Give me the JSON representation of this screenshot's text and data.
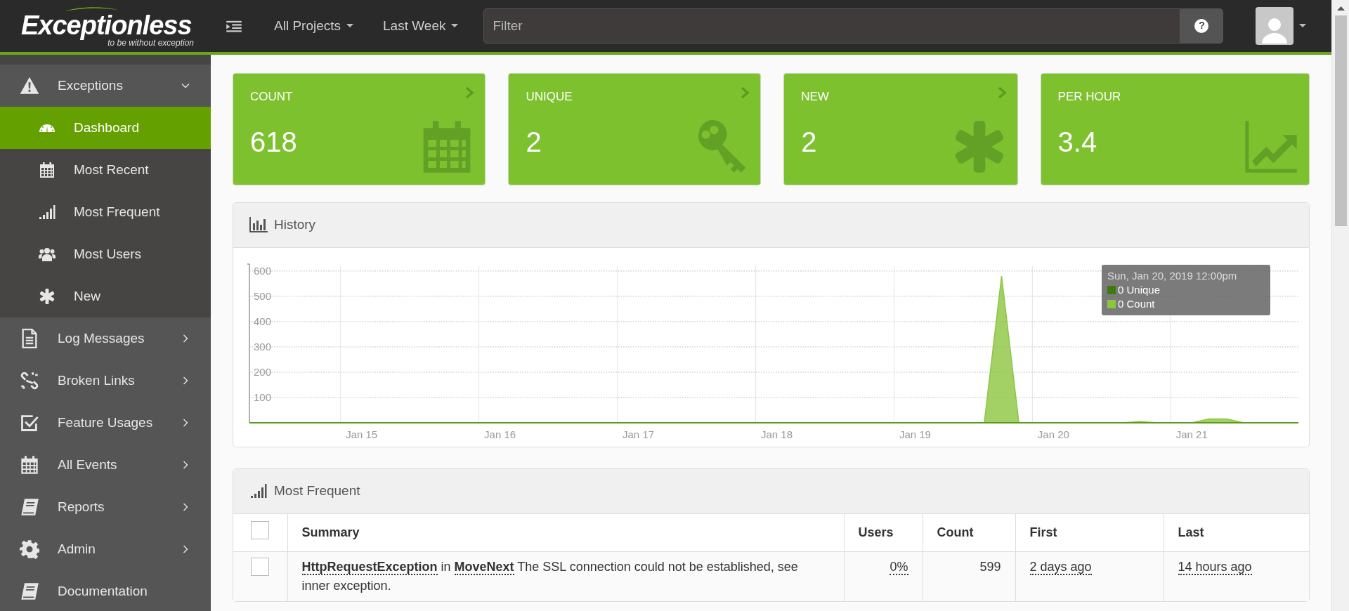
{
  "topbar": {
    "logo": "Exceptionless",
    "tagline": "to be without exception",
    "project_menu": "All Projects",
    "time_menu": "Last Week",
    "filter": {
      "placeholder": "Filter"
    },
    "help_button": "?"
  },
  "sidebar": {
    "items": [
      {
        "label": "Exceptions",
        "kind": "group",
        "expanded": true,
        "selected": false,
        "children": [
          {
            "label": "Dashboard",
            "selected": true
          },
          {
            "label": "Most Recent",
            "selected": false
          },
          {
            "label": "Most Frequent",
            "selected": false
          },
          {
            "label": "Most Users",
            "selected": false
          },
          {
            "label": "New",
            "selected": false
          }
        ]
      },
      {
        "label": "Log Messages",
        "kind": "group",
        "expanded": false,
        "selected": false
      },
      {
        "label": "Broken Links",
        "kind": "group",
        "expanded": false,
        "selected": false
      },
      {
        "label": "Feature Usages",
        "kind": "group",
        "expanded": false,
        "selected": false
      },
      {
        "label": "All Events",
        "kind": "group",
        "expanded": false,
        "selected": false
      },
      {
        "label": "Reports",
        "kind": "group",
        "expanded": false,
        "selected": false
      },
      {
        "label": "Admin",
        "kind": "group",
        "expanded": false,
        "selected": false
      },
      {
        "label": "Documentation",
        "kind": "link",
        "selected": false
      }
    ]
  },
  "stats": [
    {
      "label": "COUNT",
      "value": "618",
      "link": true
    },
    {
      "label": "UNIQUE",
      "value": "2",
      "link": true
    },
    {
      "label": "NEW",
      "value": "2",
      "link": true
    },
    {
      "label": "PER HOUR",
      "value": "3.4",
      "link": false
    }
  ],
  "history": {
    "title": "History",
    "chart_data": {
      "type": "area",
      "categories": [
        null,
        null,
        null,
        null,
        null,
        null,
        "Jan 15",
        null,
        null,
        null,
        null,
        null,
        null,
        null,
        "Jan 16",
        null,
        null,
        null,
        null,
        null,
        null,
        null,
        "Jan 17",
        null,
        null,
        null,
        null,
        null,
        null,
        null,
        "Jan 18",
        null,
        null,
        null,
        null,
        null,
        null,
        null,
        "Jan 19",
        null,
        null,
        null,
        null,
        null,
        null,
        null,
        "Jan 20",
        null,
        null,
        null,
        null,
        null,
        null,
        null,
        "Jan 21",
        null,
        null,
        null,
        null,
        null,
        null
      ],
      "series": [
        {
          "color": "#8cc63f",
          "values": [
            0,
            0,
            0,
            0,
            0,
            0,
            0,
            0,
            0,
            0,
            0,
            0,
            0,
            0,
            0,
            0,
            0,
            0,
            0,
            0,
            0,
            0,
            0,
            0,
            0,
            0,
            0,
            0,
            0,
            0,
            0,
            0,
            0,
            0,
            0,
            0,
            0,
            0,
            0,
            0,
            0,
            0,
            0,
            580,
            0,
            0,
            0,
            0,
            0,
            0,
            0,
            5,
            0,
            0,
            0,
            15,
            15,
            0,
            0,
            0,
            0
          ]
        }
      ],
      "grid": true,
      "ylim": [
        0,
        622
      ],
      "yticks": [
        100,
        200,
        300,
        400,
        500,
        600
      ]
    },
    "tooltip": {
      "title": "Sun, Jan 20, 2019 12:00pm",
      "items": [
        {
          "label": "0 Unique",
          "color": "#3f7a0d"
        },
        {
          "label": "0 Count",
          "color": "#8cc63f"
        }
      ]
    }
  },
  "most_frequent": {
    "title": "Most Frequent",
    "select_all": {
      "checked": false
    },
    "columns": [
      "Summary",
      "Users",
      "Count",
      "First",
      "Last"
    ],
    "rows": [
      {
        "checked": false,
        "type": "HttpRequestException",
        "connector": "in",
        "method": "MoveNext",
        "message": "The SSL connection could not be established, see inner exception.",
        "users": "0%",
        "count": "599",
        "first": "2 days ago",
        "last": "14 hours ago"
      }
    ]
  }
}
